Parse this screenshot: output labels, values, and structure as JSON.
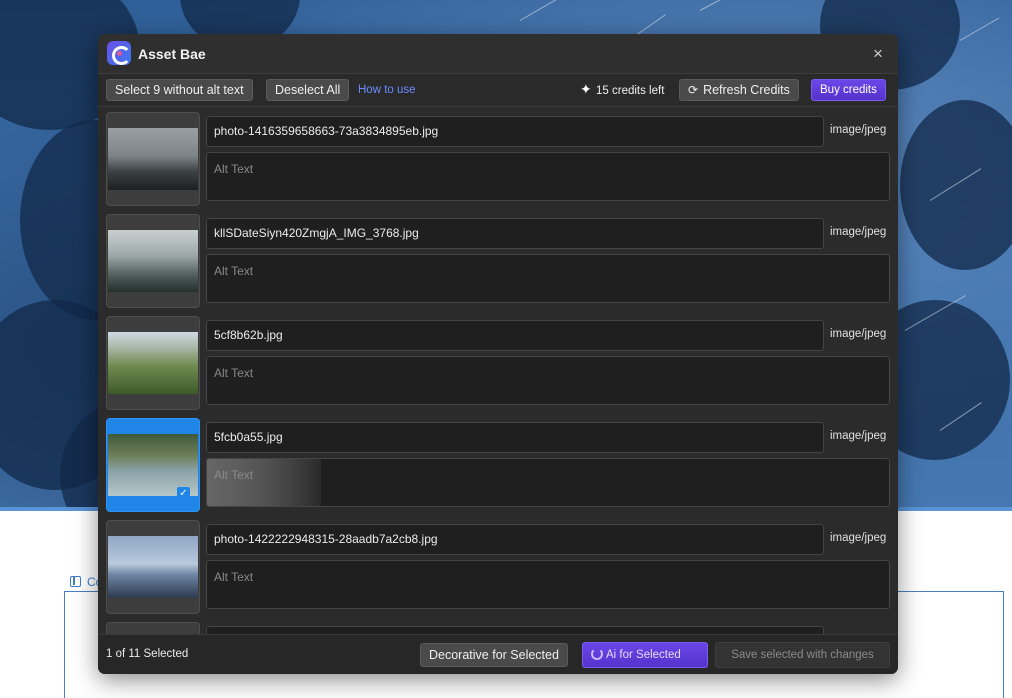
{
  "app": {
    "title": "Asset Bae",
    "close": "×"
  },
  "toolbar": {
    "select_without_alt": "Select 9 without alt text",
    "deselect_all": "Deselect All",
    "how_to_use": "How to use",
    "credits_text": "15 credits left",
    "refresh_credits": "Refresh Credits",
    "buy_credits": "Buy credits"
  },
  "assets": [
    {
      "filename": "photo-1416359658663-73a3834895eb.jpg",
      "mime": "image/jpeg",
      "alt_placeholder": "Alt Text",
      "alt_value": "",
      "selected": false,
      "thumb": "forest-dusk"
    },
    {
      "filename": "kllSDateSiyn420ZmgjA_IMG_3768.jpg",
      "mime": "image/jpeg",
      "alt_placeholder": "Alt Text",
      "alt_value": "",
      "selected": false,
      "thumb": "misty-forest"
    },
    {
      "filename": "5cf8b62b.jpg",
      "mime": "image/jpeg",
      "alt_placeholder": "Alt Text",
      "alt_value": "",
      "selected": false,
      "thumb": "green-valley"
    },
    {
      "filename": "5fcb0a55.jpg",
      "mime": "image/jpeg",
      "alt_placeholder": "Alt Text",
      "alt_value": "",
      "selected": true,
      "loading": true,
      "thumb": "moose-river"
    },
    {
      "filename": "photo-1422222948315-28aadb7a2cb8.jpg",
      "mime": "image/jpeg",
      "alt_placeholder": "Alt Text",
      "alt_value": "",
      "selected": false,
      "thumb": "silhouette-lake"
    }
  ],
  "footer": {
    "selection_status": "1 of 11 Selected",
    "decorative_for_selected": "Decorative for Selected",
    "ai_for_selected": "Ai for Selected",
    "save_selected": "Save selected with changes"
  },
  "background": {
    "editor_label": "Co"
  },
  "colors": {
    "accent_purple": "#6b46e8",
    "selected_blue": "#1f86e8",
    "link_blue": "#6b8cff"
  }
}
